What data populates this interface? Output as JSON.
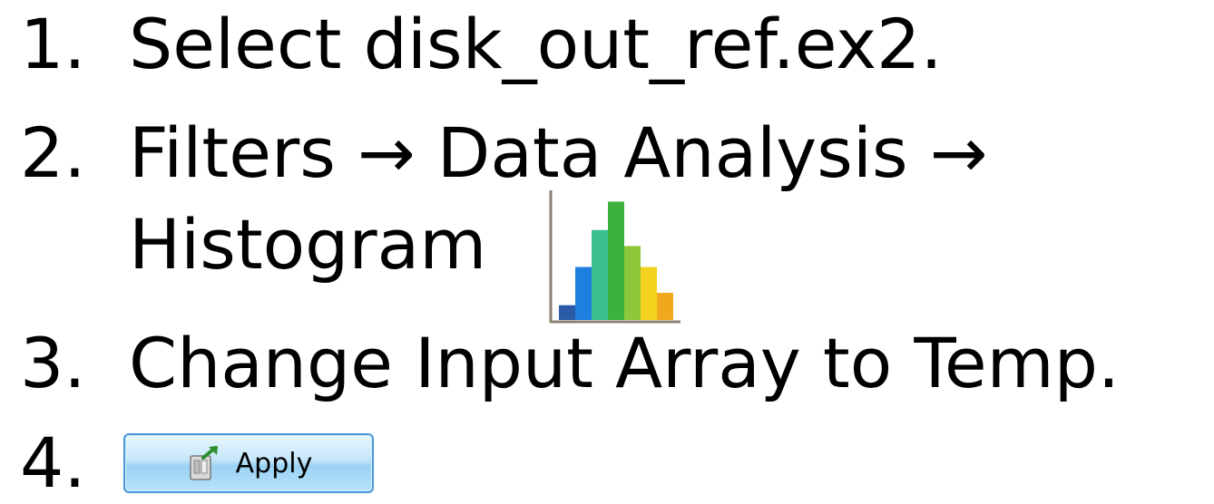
{
  "steps": [
    {
      "number": "1.",
      "text": "Select disk_out_ref.ex2."
    },
    {
      "number": "2.",
      "text": "Filters → Data Analysis →",
      "continuation": "Histogram"
    },
    {
      "number": "3.",
      "text": "Change Input Array to Temp."
    },
    {
      "number": "4.",
      "button_label": "Apply"
    }
  ],
  "icons": {
    "histogram": "histogram-icon",
    "apply": "apply-icon"
  },
  "histogram_icon": {
    "bar_colors": [
      "#2b5ba6",
      "#1f7fe0",
      "#3bbf8f",
      "#3cb23c",
      "#8ec73a",
      "#f2d21d",
      "#f2a81d"
    ],
    "bar_levels": [
      0.12,
      0.43,
      0.73,
      0.96,
      0.6,
      0.43,
      0.22
    ]
  }
}
